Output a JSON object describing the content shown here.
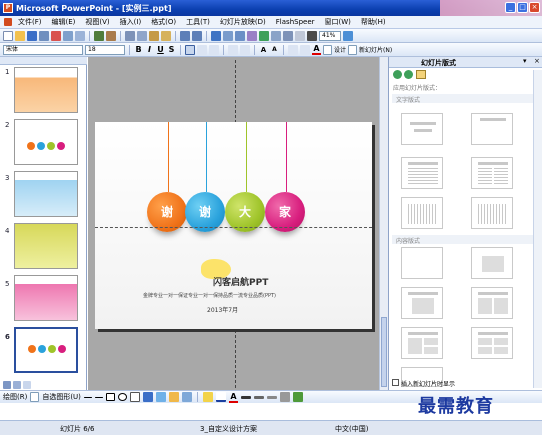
{
  "window": {
    "title": "Microsoft PowerPoint - [实例三.ppt]"
  },
  "menubar": {
    "items": [
      "文件(F)",
      "编辑(E)",
      "视图(V)",
      "插入(I)",
      "格式(O)",
      "工具(T)",
      "幻灯片放映(D)",
      "FlashSpeer",
      "窗口(W)",
      "帮助(H)"
    ]
  },
  "toolbar": {
    "zoom": "41%",
    "font": "宋体",
    "font_size": "18",
    "design_label": "设计",
    "new_slide_label": "新幻灯片(N)"
  },
  "slides": {
    "numbers": [
      "1",
      "2",
      "3",
      "4",
      "5",
      "6"
    ],
    "selected": "6"
  },
  "slide": {
    "balls": [
      "谢",
      "谢",
      "大",
      "家"
    ],
    "ball_colors": [
      "#f0731a",
      "#2aa2dc",
      "#9fc42a",
      "#d81e7e"
    ],
    "title": "闪客启航PPT",
    "subtitle": "金牌专业一对一保证专业一对一保持品质一流专业品质(PPT)",
    "date": "2013年7月"
  },
  "taskpane": {
    "title": "幻灯片版式",
    "apply_label": "应用幻灯片版式：",
    "section_text": "文字版式",
    "section_content": "内容版式",
    "checkbox_label": "插入新幻灯片时显示"
  },
  "drawbar": {
    "draw_label": "绘图(R)",
    "autoshape_label": "自选图形(U)"
  },
  "statusbar": {
    "slide_label": "幻灯片 6/6",
    "design_label": "3_自定义设计方案",
    "lang_label": "中文(中国)"
  },
  "watermark": {
    "text": "最需教育"
  }
}
